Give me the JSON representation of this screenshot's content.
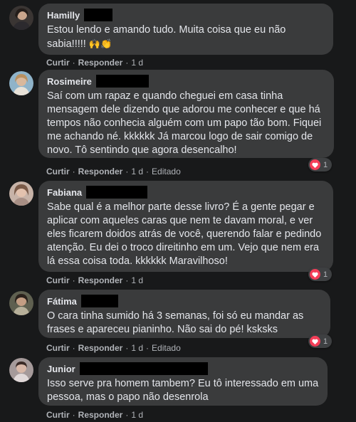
{
  "actions": {
    "like": "Curtir",
    "reply": "Responder",
    "sep": "·",
    "edited": "Editado"
  },
  "comments": [
    {
      "name": "Hamilly",
      "text": "Estou lendo e amando tudo. Muita coisa que eu não sabia!!!!! ",
      "emoji": "🙌👏",
      "time": "1 d",
      "edited": false,
      "reactions": null,
      "avatar_color": "#4a4240"
    },
    {
      "name": "Rosimeire",
      "text": "Saí com um rapaz e quando cheguei em casa tinha mensagem dele dizendo que adorou me conhecer e que há tempos não conhecia alguém com um papo tão bom. Fiquei me achando né. kkkkkk Já marcou logo de sair comigo de novo. Tô sentindo que agora desencalho!",
      "time": "1 d",
      "edited": true,
      "reactions": "1",
      "avatar_color": "#8a7f6a"
    },
    {
      "name": "Fabiana",
      "text": "Sabe qual é a melhor parte desse livro? É a gente pegar e aplicar com aqueles caras que nem te davam moral, e ver eles ficarem doidos atrás de você, querendo falar e pedindo atenção. Eu dei o troco direitinho em um. Vejo que nem era lá essa coisa toda. kkkkkk Maravilhoso!",
      "time": "1 d",
      "edited": false,
      "reactions": "1",
      "avatar_color": "#b89a8a"
    },
    {
      "name": "Fátima",
      "text": "O cara tinha sumido há 3 semanas, foi só eu mandar as frases e apareceu pianinho. Não sai do pé! ksksks",
      "time": "1 d",
      "edited": true,
      "reactions": "1",
      "avatar_color": "#6b6a55"
    },
    {
      "name": "Junior",
      "text": "Isso serve pra homem tambem? Eu tô interessado em uma pessoa, mas o papo não desenrola",
      "time": "1 d",
      "edited": false,
      "reactions": null,
      "avatar_color": "#9a8e8e"
    }
  ]
}
